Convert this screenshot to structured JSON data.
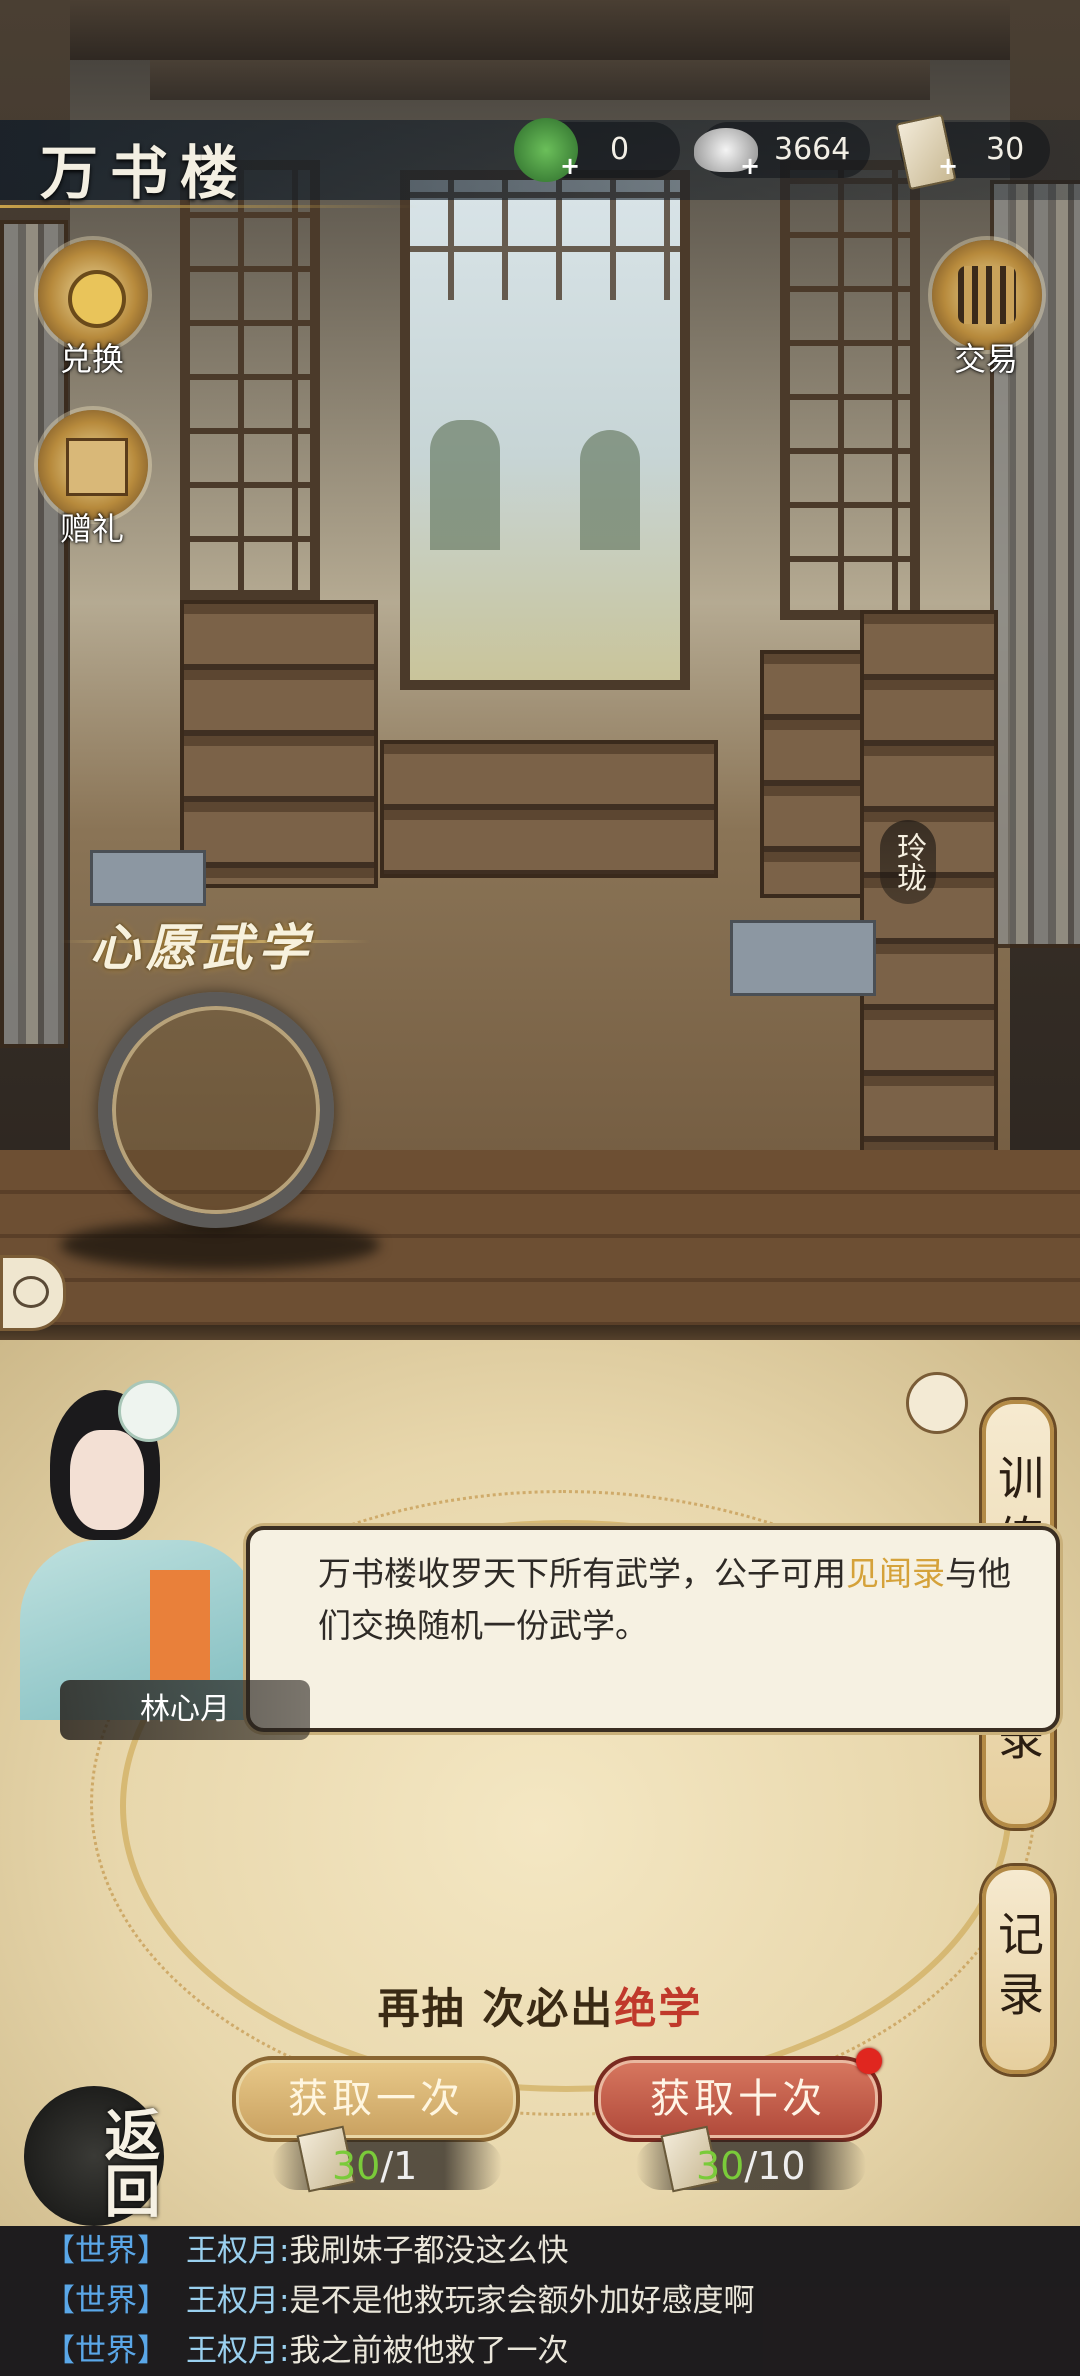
{
  "header": {
    "title": "万书楼"
  },
  "resources": [
    {
      "name": "jade-token",
      "value": "0",
      "color": "#3a8a3a"
    },
    {
      "name": "silver-ingot",
      "value": "3664",
      "color": "#c9c9c9"
    },
    {
      "name": "scroll-ticket",
      "value": "30",
      "color": "#e6d6a8"
    }
  ],
  "side_buttons": {
    "exchange": "兑换",
    "gift": "赠礼",
    "trade": "交易"
  },
  "scene": {
    "wish_label": "心愿武学",
    "npc_name": "玲珑"
  },
  "tabs": {
    "training": "训练",
    "catalog_partial": "录",
    "records": "记录"
  },
  "dialog": {
    "speaker": "林心月",
    "text_before": "万书楼收罗天下所有武学，公子可用",
    "highlight": "见闻录",
    "text_after": "与他们交换随机一份武学。"
  },
  "draw": {
    "guarantee_prefix": "再抽 ",
    "guarantee_mid": "次必出",
    "guarantee_suffix": "绝学",
    "single": {
      "label": "获取一次",
      "owned": "30",
      "cost": "/1"
    },
    "ten": {
      "label": "获取十次",
      "owned": "30",
      "cost": "/10"
    }
  },
  "back": {
    "label": "返回"
  },
  "chat": [
    {
      "channel": "【世界】",
      "user": "王权月:",
      "message": "我刷妹子都没这么快"
    },
    {
      "channel": "【世界】",
      "user": "王权月:",
      "message": "是不是他救玩家会额外加好感度啊"
    },
    {
      "channel": "【世界】",
      "user": "王权月:",
      "message": "我之前被他救了一次"
    }
  ]
}
